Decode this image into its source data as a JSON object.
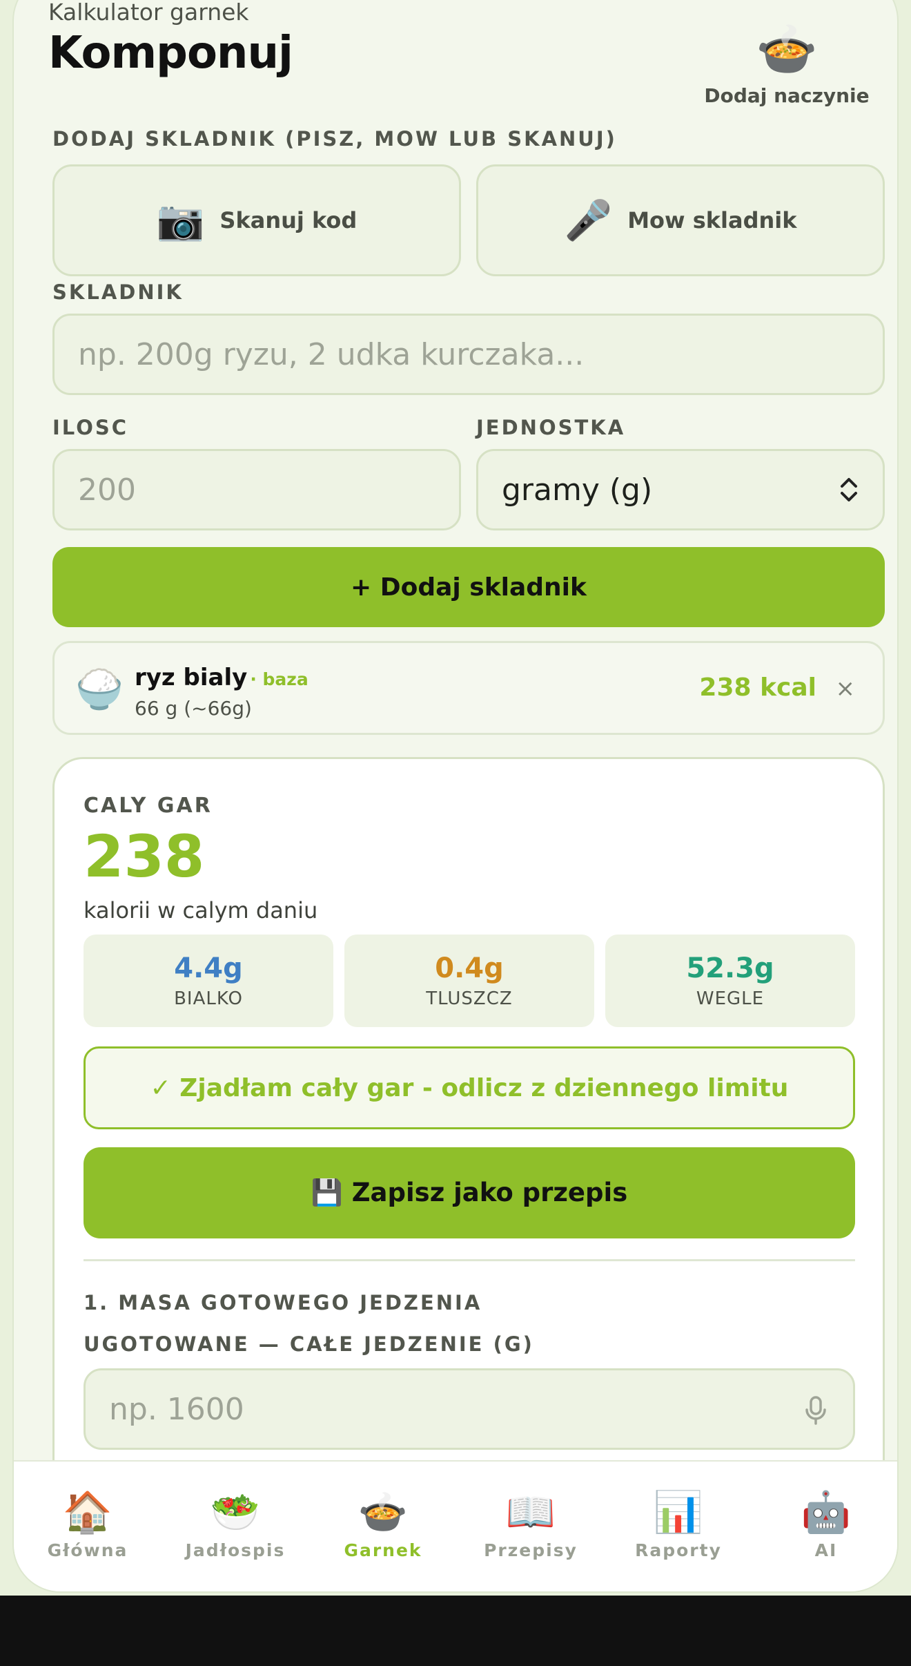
{
  "header": {
    "subtitle": "Kalkulator garnek",
    "title": "Komponuj",
    "add_dish_label": "Dodaj naczynie",
    "add_dish_icon": "pot-of-food-icon"
  },
  "add_section": {
    "label": "DODAJ SKLADNIK (PISZ, MOW LUB SKANUJ)",
    "scan_button": "Skanuj kod",
    "voice_button": "Mow skladnik"
  },
  "form": {
    "ingredient_label": "SKLADNIK",
    "ingredient_placeholder": "np. 200g ryzu, 2 udka kurczaka...",
    "amount_label": "ILOSC",
    "amount_placeholder": "200",
    "unit_label": "JEDNOSTKA",
    "unit_selected": "gramy (g)",
    "add_button": "+ Dodaj skladnik"
  },
  "ingredients": [
    {
      "name": "ryz bialy",
      "source": "· baza",
      "quantity": "66 g (~66g)",
      "kcal": "238 kcal",
      "remove": "×"
    }
  ],
  "summary": {
    "label": "CALY GAR",
    "total_kcal": "238",
    "description": "kalorii w calym daniu",
    "macros": [
      {
        "value": "4.4g",
        "name": "BIALKO",
        "color": "#3f7fc4"
      },
      {
        "value": "0.4g",
        "name": "TLUSZCZ",
        "color": "#d08a1e"
      },
      {
        "value": "52.3g",
        "name": "WEGLE",
        "color": "#23a07a"
      }
    ],
    "eat_button": "✓ Zjadłam cały gar - odlicz z dziennego limitu",
    "save_button": "💾 Zapisz jako przepis",
    "step_label": "1. MASA GOTOWEGO JEDZENIA",
    "cooked_label": "UGOTOWANE — CAŁE JEDZENIE (G)",
    "cooked_placeholder": "np. 1600"
  },
  "tabs": [
    {
      "label": "Główna",
      "icon": "🏠",
      "active": false
    },
    {
      "label": "Jadłospis",
      "icon": "🥗",
      "active": false
    },
    {
      "label": "Garnek",
      "icon": "🍲",
      "active": true
    },
    {
      "label": "Przepisy",
      "icon": "📖",
      "active": false
    },
    {
      "label": "Raporty",
      "icon": "📊",
      "active": false
    },
    {
      "label": "AI",
      "icon": "🤖",
      "active": false
    }
  ],
  "colors": {
    "accent": "#8fbf2a",
    "background": "#f3f7ec"
  }
}
